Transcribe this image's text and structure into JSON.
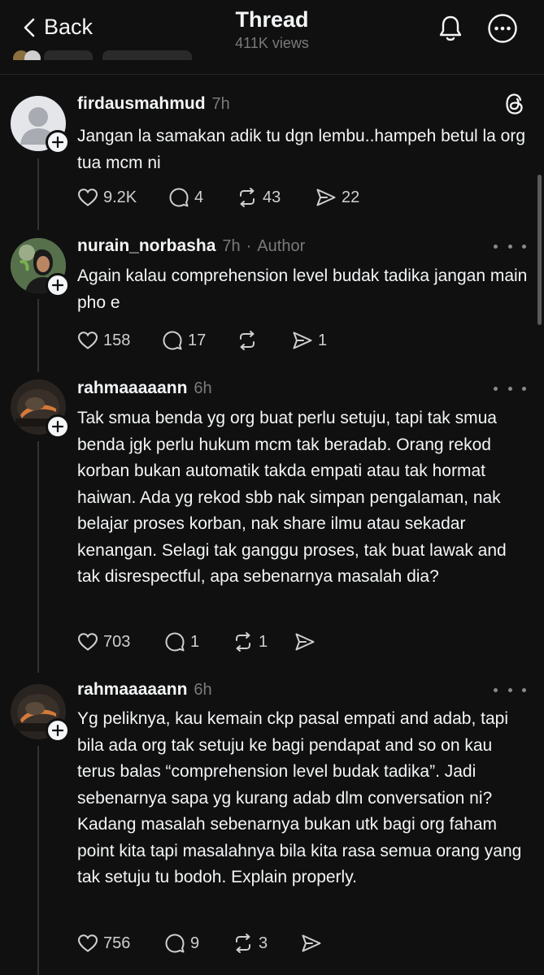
{
  "header": {
    "back_label": "Back",
    "title": "Thread",
    "views": "411K views"
  },
  "icons": {
    "back": "chevron-left-icon",
    "notifications": "bell-icon",
    "more": "more-circle-icon",
    "threads": "threads-logo-icon",
    "like": "heart-icon",
    "reply": "comment-icon",
    "repost": "repost-icon",
    "share": "send-icon"
  },
  "posts": [
    {
      "username": "firdausmahmud",
      "time": "7h",
      "author": "",
      "body": "Jangan la samakan adik tu dgn lembu..hampeh betul la org tua mcm ni",
      "likes": "9.2K",
      "replies": "4",
      "reposts": "43",
      "shares": "22"
    },
    {
      "username": "nurain_norbasha",
      "time": "7h",
      "author": "Author",
      "body": "Again kalau comprehension level budak tadika jangan main pho e",
      "likes": "158",
      "replies": "17",
      "reposts": "",
      "shares": "1"
    },
    {
      "username": "rahmaaaaann",
      "time": "6h",
      "author": "",
      "body": "Tak smua benda yg org buat perlu setuju, tapi tak smua benda jgk perlu hukum mcm tak beradab. Orang rekod korban bukan automatik takda empati atau tak hormat haiwan. Ada yg rekod sbb nak simpan pengalaman, nak belajar proses korban, nak share ilmu atau sekadar kenangan. Selagi tak ganggu proses, tak buat lawak and tak disrespectful, apa sebenarnya masalah dia?",
      "likes": "703",
      "replies": "1",
      "reposts": "1",
      "shares": ""
    },
    {
      "username": "rahmaaaaann",
      "time": "6h",
      "author": "",
      "body": "Yg peliknya, kau kemain ckp pasal empati and adab, tapi bila ada org tak setuju ke bagi pendapat and so on kau terus balas “comprehension level budak tadika”. Jadi sebenarnya sapa yg kurang adab dlm conversation ni? Kadang masalah sebenarnya bukan utk bagi org faham point kita tapi masalahnya bila kita rasa semua orang yang tak setuju tu bodoh. Explain properly.",
      "likes": "756",
      "replies": "9",
      "reposts": "3",
      "shares": ""
    }
  ]
}
